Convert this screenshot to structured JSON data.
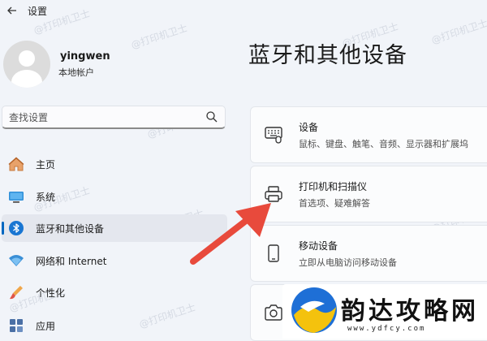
{
  "window": {
    "title": "设置"
  },
  "profile": {
    "name": "yingwen",
    "account_type": "本地帐户"
  },
  "search": {
    "placeholder": "查找设置"
  },
  "sidebar": {
    "items": [
      {
        "label": "主页",
        "icon": "home-icon",
        "active": false
      },
      {
        "label": "系统",
        "icon": "system-icon",
        "active": false
      },
      {
        "label": "蓝牙和其他设备",
        "icon": "bluetooth-icon",
        "active": true
      },
      {
        "label": "网络和 Internet",
        "icon": "wifi-icon",
        "active": false
      },
      {
        "label": "个性化",
        "icon": "brush-icon",
        "active": false
      },
      {
        "label": "应用",
        "icon": "apps-icon",
        "active": false
      }
    ]
  },
  "main": {
    "title": "蓝牙和其他设备",
    "cards": [
      {
        "title": "设备",
        "subtitle": "鼠标、键盘、触笔、音频、显示器和扩展坞",
        "icon": "devices-icon"
      },
      {
        "title": "打印机和扫描仪",
        "subtitle": "首选项、疑难解答",
        "icon": "printer-icon"
      },
      {
        "title": "移动设备",
        "subtitle": "立即从电脑访问移动设备",
        "icon": "phone-icon"
      },
      {
        "title": "",
        "subtitle": "",
        "icon": "camera-icon"
      }
    ]
  },
  "watermark": {
    "text": "@打印机卫士"
  },
  "logo": {
    "text": "韵达攻略网",
    "url": "www.ydfcy.com"
  },
  "colors": {
    "accent": "#0067c0",
    "background": "#f1f4f9",
    "arrow": "#e84a3c"
  }
}
